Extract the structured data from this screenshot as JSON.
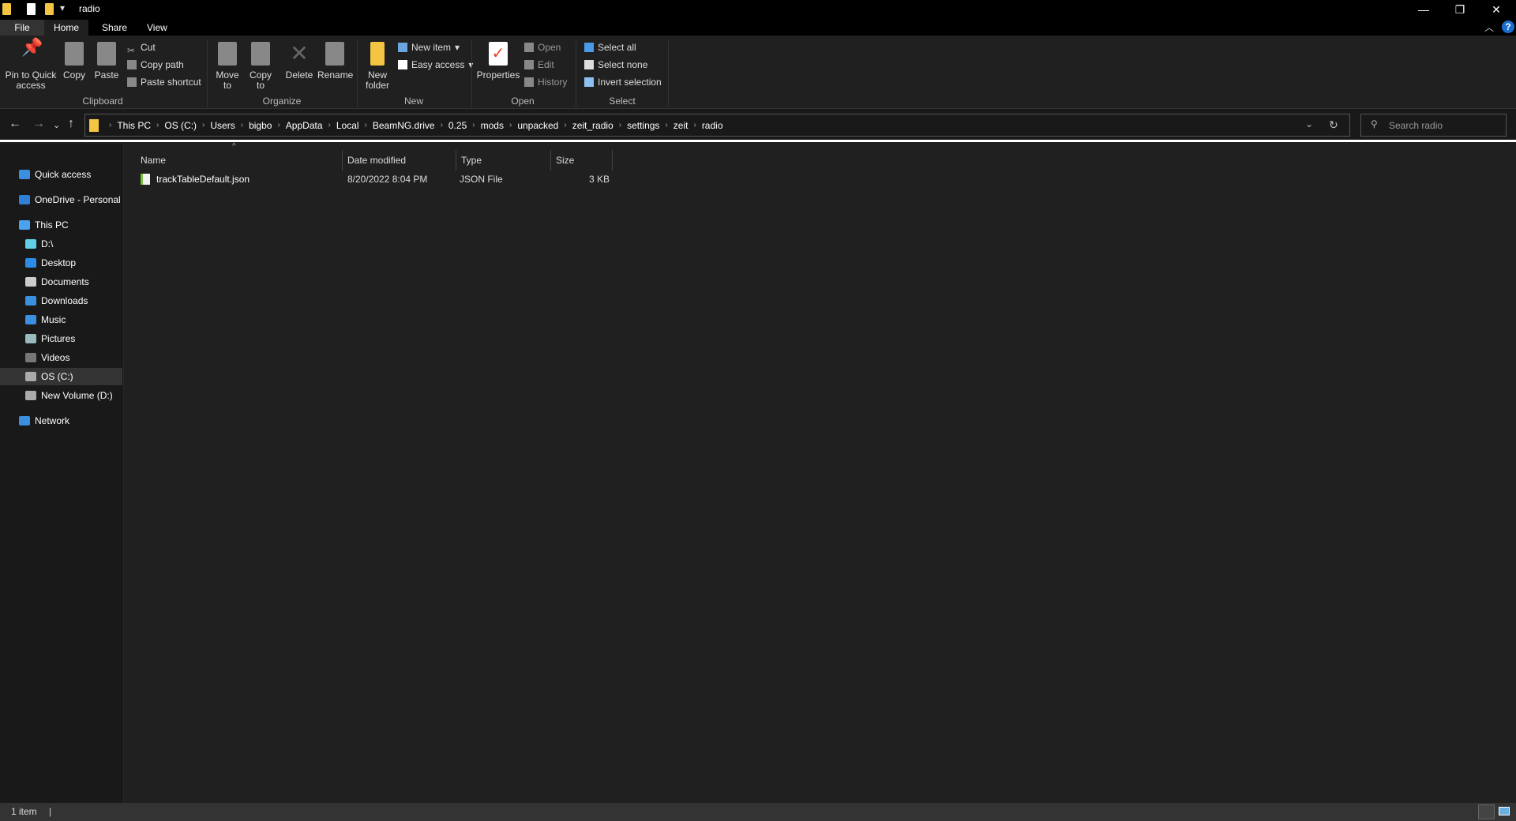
{
  "window": {
    "title": "radio"
  },
  "tabs": [
    "File",
    "Home",
    "Share",
    "View"
  ],
  "ribbon": {
    "clipboard": {
      "pin": "Pin to Quick access",
      "copy": "Copy",
      "paste": "Paste",
      "cut": "Cut",
      "copy_path": "Copy path",
      "paste_shortcut": "Paste shortcut",
      "label": "Clipboard"
    },
    "organize": {
      "move_to": "Move to",
      "copy_to": "Copy to",
      "delete": "Delete",
      "rename": "Rename",
      "label": "Organize"
    },
    "new": {
      "new_folder": "New folder",
      "new_item": "New item",
      "easy_access": "Easy access",
      "label": "New"
    },
    "open": {
      "properties": "Properties",
      "open": "Open",
      "edit": "Edit",
      "history": "History",
      "label": "Open"
    },
    "select": {
      "select_all": "Select all",
      "select_none": "Select none",
      "invert": "Invert selection",
      "label": "Select"
    }
  },
  "breadcrumb": [
    "This PC",
    "OS (C:)",
    "Users",
    "bigbo",
    "AppData",
    "Local",
    "BeamNG.drive",
    "0.25",
    "mods",
    "unpacked",
    "zeit_radio",
    "settings",
    "zeit",
    "radio"
  ],
  "search": {
    "placeholder": "Search radio"
  },
  "sidebar": [
    {
      "label": "Quick access",
      "icon": "star-icon",
      "color": "#3b8fe0"
    },
    {
      "label": "OneDrive - Personal",
      "icon": "cloud-icon",
      "color": "#2f7fd6"
    },
    {
      "label": "This PC",
      "icon": "monitor-icon",
      "color": "#4aa3f0"
    },
    {
      "label": "D:\\",
      "icon": "cube-icon",
      "color": "#5fd0e8"
    },
    {
      "label": "Desktop",
      "icon": "desktop-icon",
      "color": "#2b8be6"
    },
    {
      "label": "Documents",
      "icon": "document-icon",
      "color": "#ccc"
    },
    {
      "label": "Downloads",
      "icon": "download-icon",
      "color": "#3b8fe0"
    },
    {
      "label": "Music",
      "icon": "music-icon",
      "color": "#3b8fe0"
    },
    {
      "label": "Pictures",
      "icon": "pictures-icon",
      "color": "#9bb"
    },
    {
      "label": "Videos",
      "icon": "video-icon",
      "color": "#777"
    },
    {
      "label": "OS (C:)",
      "icon": "drive-icon",
      "color": "#aaa",
      "selected": true
    },
    {
      "label": "New Volume (D:)",
      "icon": "drive-icon",
      "color": "#aaa"
    },
    {
      "label": "Network",
      "icon": "network-icon",
      "color": "#3b8fe0"
    }
  ],
  "columns": [
    "Name",
    "Date modified",
    "Type",
    "Size"
  ],
  "files": [
    {
      "name": "trackTableDefault.json",
      "date": "8/20/2022 8:04 PM",
      "type": "JSON File",
      "size": "3 KB"
    }
  ],
  "status": {
    "count": "1 item"
  }
}
